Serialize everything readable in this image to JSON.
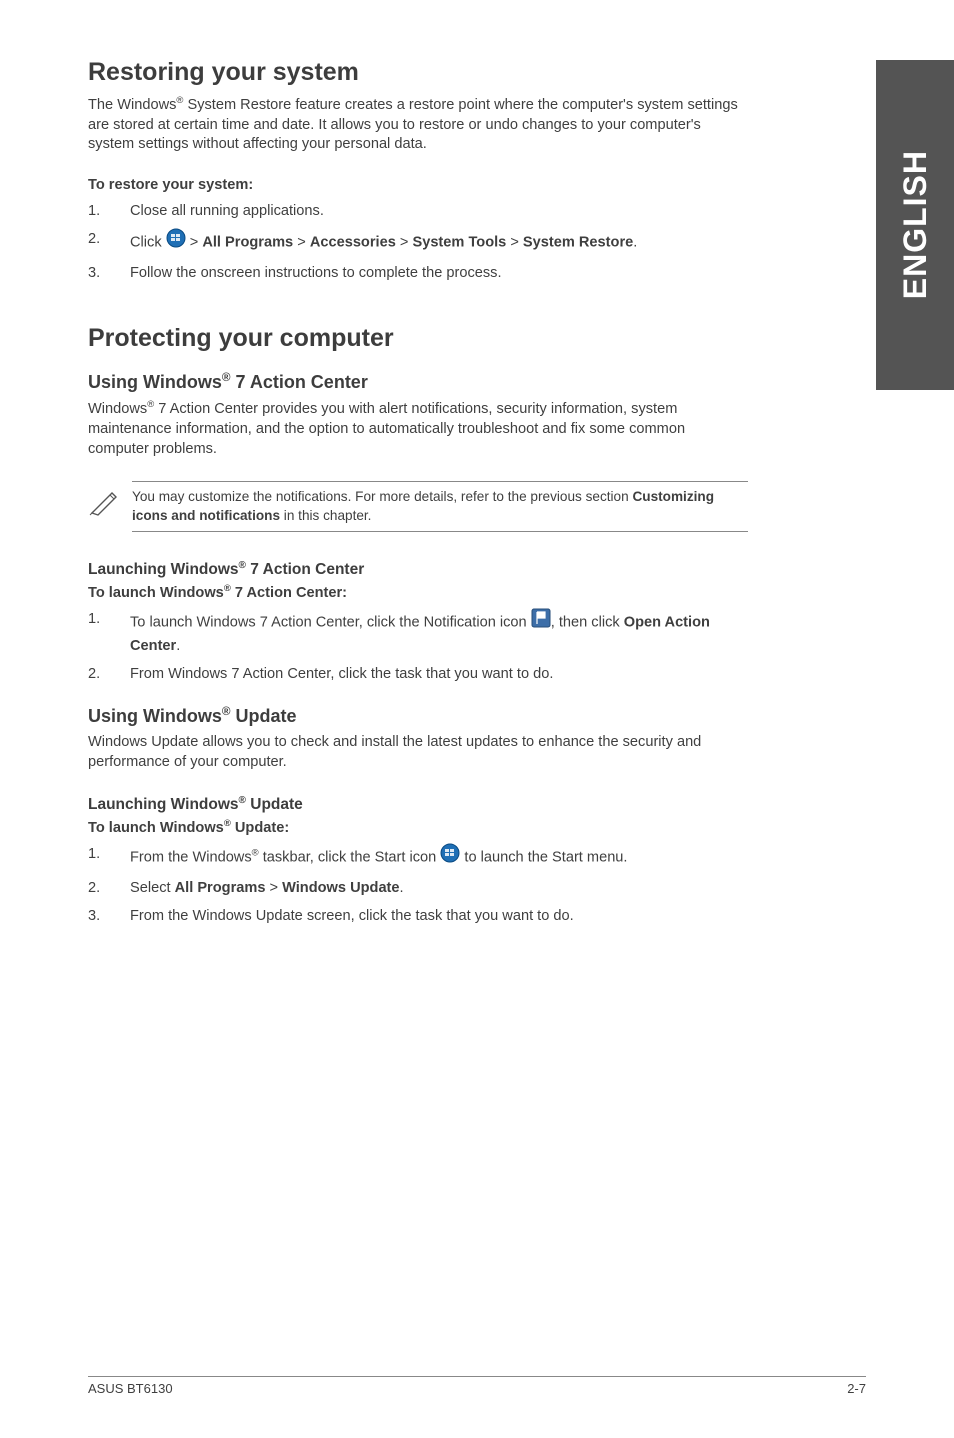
{
  "sideTab": "ENGLISH",
  "section1": {
    "title": "Restoring your system",
    "intro_a": "The Windows",
    "intro_b": " System Restore feature creates a restore point where the computer's system settings are stored at certain time and date. It allows you to restore or undo changes to your computer's system settings without affecting your personal data.",
    "subhead": "To restore your system:",
    "steps": {
      "s1": "Close all running applications.",
      "s2a": "Click ",
      "s2b": " > ",
      "s2_allprograms": "All Programs",
      "s2c": " > ",
      "s2_accessories": "Accessories",
      "s2d": " > ",
      "s2_systools": "System Tools",
      "s2e": " > ",
      "s2_sysrestore": "System Restore",
      "s2f": ".",
      "s3": "Follow the onscreen instructions to complete the process."
    }
  },
  "section2": {
    "title": "Protecting your computer",
    "h2a_a": "Using Windows",
    "h2a_b": " 7 Action Center",
    "intro_a": "Windows",
    "intro_b": " 7 Action Center provides you with alert notifications, security information, system maintenance information, and the option to automatically troubleshoot and fix some common computer problems.",
    "note_a": "You may customize the notifications. For more details, refer to the previous section ",
    "note_b": "Customizing icons and notifications",
    "note_c": " in this chapter.",
    "h3a_a": "Launching Windows",
    "h3a_b": " 7 Action Center",
    "sub_a_a": "To launch Windows",
    "sub_a_b": " 7 Action Center:",
    "stepsA": {
      "s1a": "To launch Windows 7 Action Center, click the Notification icon ",
      "s1b": ", then click ",
      "s1_open": "Open Action Center",
      "s1c": ".",
      "s2": "From Windows 7 Action Center, click the task that you want to do."
    },
    "h2b_a": "Using Windows",
    "h2b_b": " Update",
    "introB": "Windows Update allows you to check and install the latest updates to enhance the security and performance of your computer.",
    "h3b_a": "Launching Windows",
    "h3b_b": " Update",
    "sub_b_a": "To launch Windows",
    "sub_b_b": " Update:",
    "stepsB": {
      "s1a": "From the Windows",
      "s1b": " taskbar, click the Start icon ",
      "s1c": " to launch the Start menu.",
      "s2a": "Select ",
      "s2_allprograms": "All Programs",
      "s2b": " > ",
      "s2_winupdate": "Windows Update",
      "s2c": ".",
      "s3": "From the Windows Update screen, click the task that you want to do."
    }
  },
  "footer": {
    "left": "ASUS BT6130",
    "right": "2-7"
  },
  "nums": {
    "n1": "1.",
    "n2": "2.",
    "n3": "3."
  },
  "reg": "®"
}
